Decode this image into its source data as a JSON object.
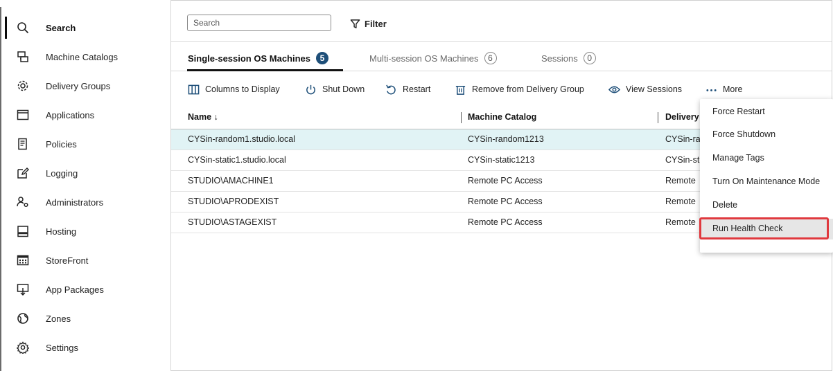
{
  "sidebar": {
    "items": [
      {
        "label": "Search",
        "icon": "search-icon",
        "active": true
      },
      {
        "label": "Machine Catalogs",
        "icon": "machine-catalogs-icon"
      },
      {
        "label": "Delivery Groups",
        "icon": "delivery-groups-icon"
      },
      {
        "label": "Applications",
        "icon": "applications-icon"
      },
      {
        "label": "Policies",
        "icon": "policies-icon"
      },
      {
        "label": "Logging",
        "icon": "logging-icon"
      },
      {
        "label": "Administrators",
        "icon": "administrators-icon"
      },
      {
        "label": "Hosting",
        "icon": "hosting-icon"
      },
      {
        "label": "StoreFront",
        "icon": "storefront-icon"
      },
      {
        "label": "App Packages",
        "icon": "app-packages-icon"
      },
      {
        "label": "Zones",
        "icon": "zones-icon"
      },
      {
        "label": "Settings",
        "icon": "settings-icon"
      }
    ]
  },
  "search": {
    "placeholder": "Search"
  },
  "filter": {
    "label": "Filter",
    "icon": "filter-icon"
  },
  "tabs": [
    {
      "label": "Single-session OS Machines",
      "count": "5",
      "active": true
    },
    {
      "label": "Multi-session OS Machines",
      "count": "6"
    },
    {
      "label": "Sessions",
      "count": "0"
    }
  ],
  "toolbar": {
    "columns": "Columns to Display",
    "shutdown": "Shut Down",
    "restart": "Restart",
    "remove": "Remove from Delivery Group",
    "view_sessions": "View Sessions",
    "more": "More"
  },
  "table": {
    "columns": [
      "Name ↓",
      "Machine Catalog",
      "Delivery"
    ],
    "rows": [
      {
        "name": "CYSin-random1.studio.local",
        "catalog": "CYSin-random1213",
        "delivery": "CYSin-ra",
        "selected": true
      },
      {
        "name": "CYSin-static1.studio.local",
        "catalog": "CYSin-static1213",
        "delivery": "CYSin-st"
      },
      {
        "name": "STUDIO\\AMACHINE1",
        "catalog": "Remote PC Access",
        "delivery": "Remote"
      },
      {
        "name": "STUDIO\\APRODEXIST",
        "catalog": "Remote PC Access",
        "delivery": "Remote"
      },
      {
        "name": "STUDIO\\ASTAGEXIST",
        "catalog": "Remote PC Access",
        "delivery": "Remote"
      }
    ]
  },
  "more_menu": {
    "items": [
      "Force Restart",
      "Force Shutdown",
      "Manage Tags",
      "Turn On Maintenance Mode",
      "Delete",
      "Run Health Check"
    ],
    "highlighted": "Run Health Check"
  },
  "colors": {
    "accent": "#1e4f79",
    "selected_row": "#e1f3f5",
    "highlight_border": "#e0393e"
  }
}
